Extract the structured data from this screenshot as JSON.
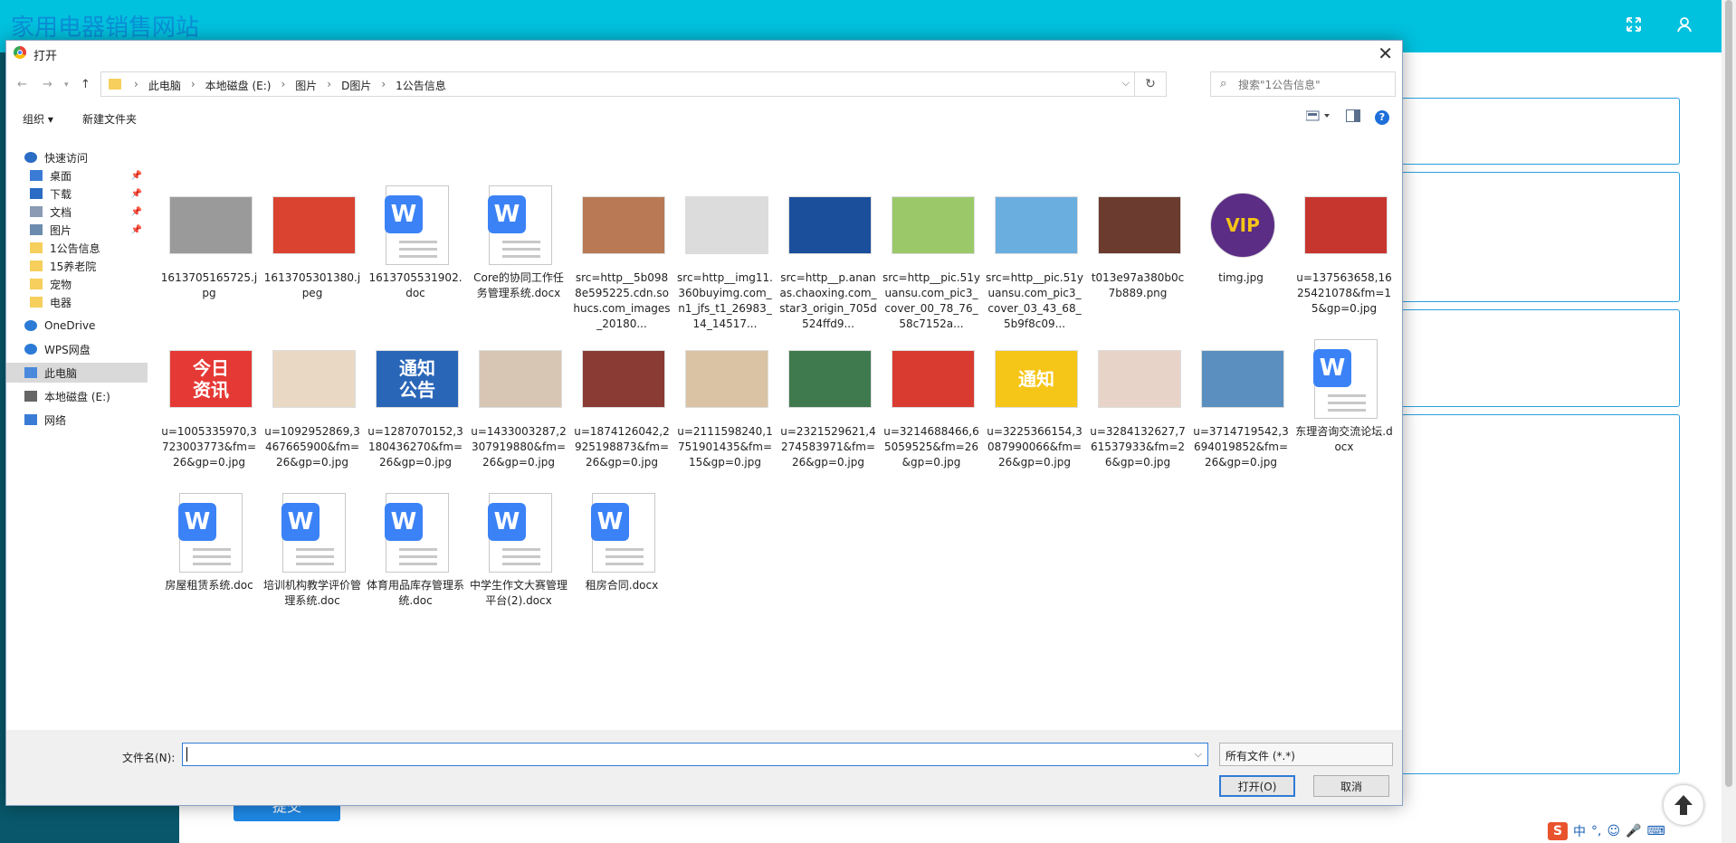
{
  "page": {
    "title": "家用电器销售网站",
    "submit_label": "提交"
  },
  "dialog": {
    "title": "打开",
    "breadcrumbs": [
      "此电脑",
      "本地磁盘 (E:)",
      "图片",
      "D图片",
      "1公告信息"
    ],
    "search_placeholder": "搜索\"1公告信息\"",
    "toolbar": {
      "organize": "组织 ▾",
      "new_folder": "新建文件夹"
    },
    "nav": [
      {
        "label": "快速访问",
        "icon": "star-icon"
      },
      {
        "label": "桌面",
        "icon": "desktop-icon",
        "pinned": true
      },
      {
        "label": "下载",
        "icon": "download-icon",
        "pinned": true
      },
      {
        "label": "文档",
        "icon": "document-icon",
        "pinned": true
      },
      {
        "label": "图片",
        "icon": "picture-icon",
        "pinned": true
      },
      {
        "label": "1公告信息",
        "icon": "folder-icon"
      },
      {
        "label": "15养老院",
        "icon": "folder-icon"
      },
      {
        "label": "宠物",
        "icon": "folder-icon"
      },
      {
        "label": "电器",
        "icon": "folder-icon"
      },
      {
        "label": "OneDrive",
        "icon": "cloud-icon"
      },
      {
        "label": "WPS网盘",
        "icon": "cloud-icon"
      },
      {
        "label": "此电脑",
        "icon": "computer-icon",
        "selected": true
      },
      {
        "label": "本地磁盘 (E:)",
        "icon": "drive-icon"
      },
      {
        "label": "网络",
        "icon": "network-icon"
      }
    ],
    "files": [
      {
        "name": "1613705165725.jpg",
        "kind": "image",
        "color": "#9a9a9a"
      },
      {
        "name": "1613705301380.jpeg",
        "kind": "image",
        "color": "#d9432f"
      },
      {
        "name": "1613705531902.doc",
        "kind": "doc"
      },
      {
        "name": "Core的协同工作任务管理系统.docx",
        "kind": "doc"
      },
      {
        "name": "src=http__5b0988e595225.cdn.sohucs.com_images_20180...",
        "kind": "image",
        "color": "#b87954"
      },
      {
        "name": "src=http__img11.360buyimg.com_n1_jfs_t1_26983_14_14517...",
        "kind": "image",
        "color": "#dcdcdc"
      },
      {
        "name": "src=http__p.ananas.chaoxing.com_star3_origin_705d524ffd9...",
        "kind": "image",
        "color": "#1b4f9c"
      },
      {
        "name": "src=http__pic.51yuansu.com_pic3_cover_00_78_76_58c7152a...",
        "kind": "image",
        "color": "#9bc96a"
      },
      {
        "name": "src=http__pic.51yuansu.com_pic3_cover_03_43_68_5b9f8c09...",
        "kind": "image",
        "color": "#6aaee0"
      },
      {
        "name": "t013e97a380b0c7b889.png",
        "kind": "image",
        "color": "#6a3b2e"
      },
      {
        "name": "timg.jpg",
        "kind": "image",
        "color": "#5b2d84"
      },
      {
        "name": "u=137563658,1625421078&fm=15&gp=0.jpg",
        "kind": "image",
        "color": "#c7352f"
      },
      {
        "name": "u=1005335970,3723003773&fm=26&gp=0.jpg",
        "kind": "image",
        "color": "#e53935"
      },
      {
        "name": "u=1092952869,3467665900&fm=26&gp=0.jpg",
        "kind": "image",
        "color": "#e9d8c4"
      },
      {
        "name": "u=1287070152,3180436270&fm=26&gp=0.jpg",
        "kind": "image",
        "color": "#2a66b8"
      },
      {
        "name": "u=1433003287,2307919880&fm=26&gp=0.jpg",
        "kind": "image",
        "color": "#d8c6b4"
      },
      {
        "name": "u=1874126042,2925198873&fm=26&gp=0.jpg",
        "kind": "image",
        "color": "#8a3b33"
      },
      {
        "name": "u=2111598240,1751901435&fm=15&gp=0.jpg",
        "kind": "image",
        "color": "#d9c3a4"
      },
      {
        "name": "u=2321529621,4274583971&fm=26&gp=0.jpg",
        "kind": "image",
        "color": "#3f7a4f"
      },
      {
        "name": "u=3214688466,65059525&fm=26&gp=0.jpg",
        "kind": "image",
        "color": "#d93b31"
      },
      {
        "name": "u=3225366154,3087990066&fm=26&gp=0.jpg",
        "kind": "image",
        "color": "#f5c518"
      },
      {
        "name": "u=3284132627,761537933&fm=26&gp=0.jpg",
        "kind": "image",
        "color": "#e8d3c8"
      },
      {
        "name": "u=3714719542,3694019852&fm=26&gp=0.jpg",
        "kind": "image",
        "color": "#5a8fbf"
      },
      {
        "name": "东理咨询交流论坛.docx",
        "kind": "doc"
      },
      {
        "name": "房屋租赁系统.doc",
        "kind": "doc"
      },
      {
        "name": "培训机构教学评价管理系统.doc",
        "kind": "doc"
      },
      {
        "name": "体育用品库存管理系统.doc",
        "kind": "doc"
      },
      {
        "name": "中学生作文大赛管理平台(2).docx",
        "kind": "doc"
      },
      {
        "name": "租房合同.docx",
        "kind": "doc"
      }
    ],
    "image_texts": {
      "u=1005335970,3723003773&fm=26&gp=0.jpg": "今日\n资讯",
      "u=1287070152,3180436270&fm=26&gp=0.jpg": "通知\n公告",
      "u=3225366154,3087990066&fm=26&gp=0.jpg": "通知",
      "timg.jpg": "VIP"
    },
    "filename_label": "文件名(N):",
    "filename_value": "",
    "filetype": "所有文件 (*.*)",
    "open_label": "打开(O)",
    "cancel_label": "取消"
  },
  "tray": {
    "ime": "中",
    "items": [
      "°,",
      "☺",
      "🎤",
      "⌨"
    ]
  }
}
